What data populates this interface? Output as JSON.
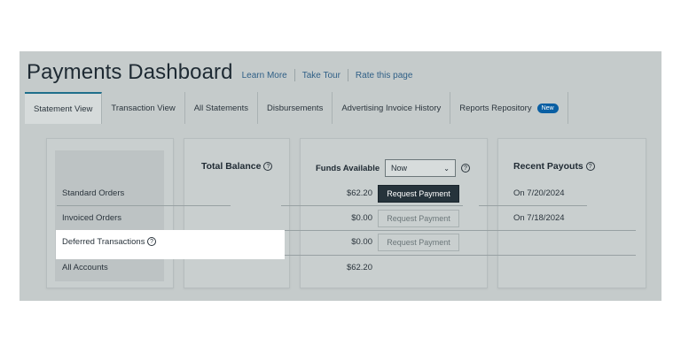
{
  "header": {
    "title": "Payments Dashboard",
    "links": [
      "Learn More",
      "Take Tour",
      "Rate this page"
    ]
  },
  "tabs": [
    {
      "label": "Statement View",
      "active": true
    },
    {
      "label": "Transaction View"
    },
    {
      "label": "All Statements"
    },
    {
      "label": "Disbursements"
    },
    {
      "label": "Advertising Invoice History"
    },
    {
      "label": "Reports Repository",
      "badge": "New"
    }
  ],
  "rows": {
    "standard": "Standard Orders",
    "invoiced": "Invoiced Orders",
    "deferred": "Deferred Transactions",
    "all": "All Accounts"
  },
  "total_balance": {
    "heading": "Total Balance"
  },
  "funds": {
    "heading": "Funds Available",
    "select_value": "Now",
    "amounts": [
      "$62.20",
      "$0.00",
      "$0.00",
      "$62.20"
    ],
    "button_label": "Request Payment"
  },
  "payouts": {
    "heading": "Recent Payouts",
    "dates": [
      "On 7/20/2024",
      "On 7/18/2024"
    ]
  },
  "icons": {
    "help": "help-circle-icon",
    "dropdown": "chevron-down-icon"
  },
  "colors": {
    "primary_button": "#26333b",
    "badge": "#0a5fa3",
    "active_tab": "#1f6f8b",
    "link": "#2f5f86"
  }
}
